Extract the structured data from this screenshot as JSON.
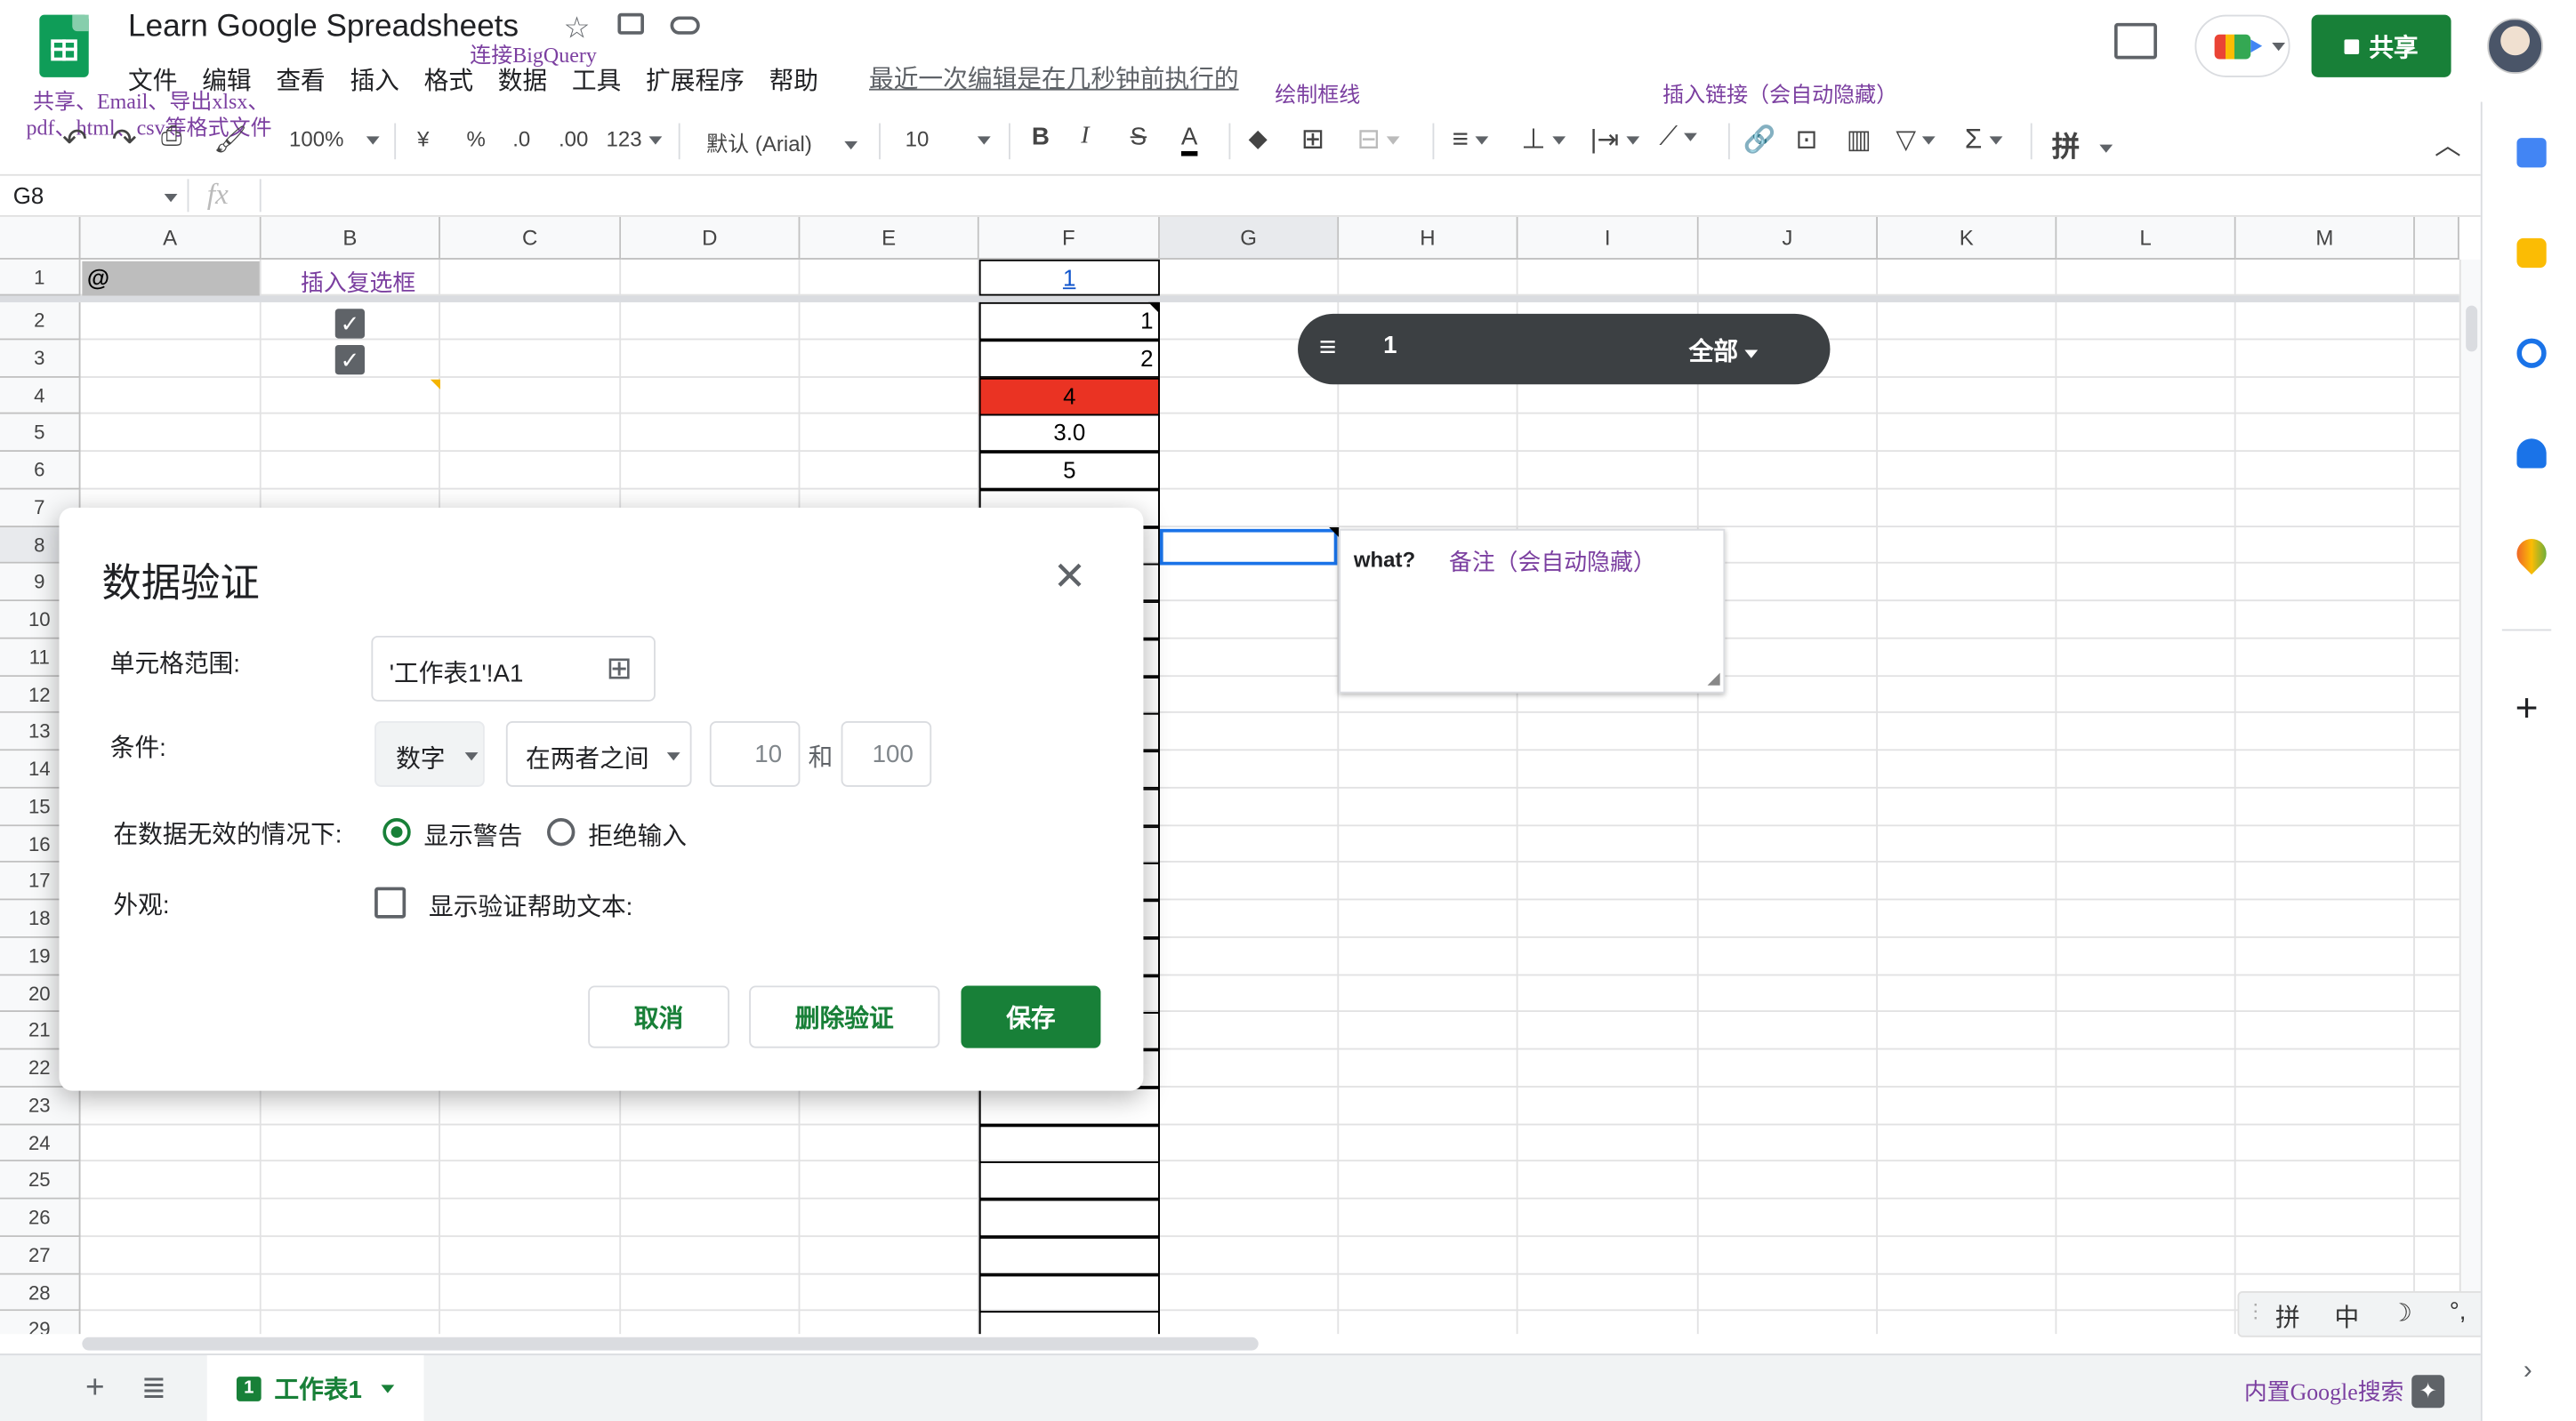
{
  "doc": {
    "title": "Learn Google Spreadsheets",
    "last_edit": "最近一次编辑是在几秒钟前执行的"
  },
  "menu": [
    "文件",
    "编辑",
    "查看",
    "插入",
    "格式",
    "数据",
    "工具",
    "扩展程序",
    "帮助"
  ],
  "share": {
    "label": "共享"
  },
  "annotations": {
    "share_export_line1": "共享、Email、导出xlsx、",
    "share_export_line2": "pdf、html、csv等格式文件",
    "bigquery": "连接BigQuery",
    "draw_border": "绘制框线",
    "insert_link": "插入链接（会自动隐藏）",
    "insert_checkbox": "插入复选框",
    "note_hint": "备注（会自动隐藏）",
    "builtin_search": "内置Google搜索"
  },
  "toolbar": {
    "zoom": "100%",
    "currency": "¥",
    "percent": "%",
    "dec_less": ".0",
    "dec_more": ".00",
    "format_more": "123",
    "font": "默认 (Arial)",
    "font_size": "10",
    "bold": "B",
    "italic": "I",
    "strike": "S",
    "text_color": "A",
    "ime_toggle": "拼"
  },
  "formula_bar": {
    "cell_ref": "G8",
    "fx": "fx"
  },
  "grid": {
    "columns": [
      "A",
      "B",
      "C",
      "D",
      "E",
      "F",
      "G",
      "H",
      "I",
      "J",
      "K",
      "L",
      "M"
    ],
    "rows": [
      "1",
      "2",
      "3",
      "4",
      "5",
      "6",
      "7",
      "8",
      "9",
      "10",
      "11",
      "12",
      "13",
      "14",
      "15",
      "16",
      "17",
      "18",
      "19",
      "20",
      "21",
      "22",
      "23",
      "24",
      "25",
      "26",
      "27",
      "28",
      "29"
    ],
    "a1": "@",
    "f1": "1",
    "f_values": [
      "1",
      "2",
      "4",
      "3.0",
      "5"
    ]
  },
  "filter": {
    "count": "1",
    "scope": "全部"
  },
  "note": {
    "text": "what?"
  },
  "dialog": {
    "title": "数据验证",
    "range_label": "单元格范围:",
    "range_value": "'工作表1'!A1",
    "criteria_label": "条件:",
    "criteria_type": "数字",
    "criteria_op": "在两者之间",
    "min": "10",
    "and": "和",
    "max": "100",
    "invalid_label": "在数据无效的情况下:",
    "show_warning": "显示警告",
    "reject_input": "拒绝输入",
    "appearance_label": "外观:",
    "help_text": "显示验证帮助文本:",
    "cancel": "取消",
    "remove": "删除验证",
    "save": "保存"
  },
  "sheets": {
    "active": "工作表1",
    "num": "1"
  },
  "ime": {
    "pin": "拼",
    "zhong": "中",
    "moon": "☽",
    "punct": "°,"
  },
  "colors": {
    "brand_green": "#188038",
    "red_fill": "#ea3323",
    "annotation_purple": "#7b3fa0"
  }
}
